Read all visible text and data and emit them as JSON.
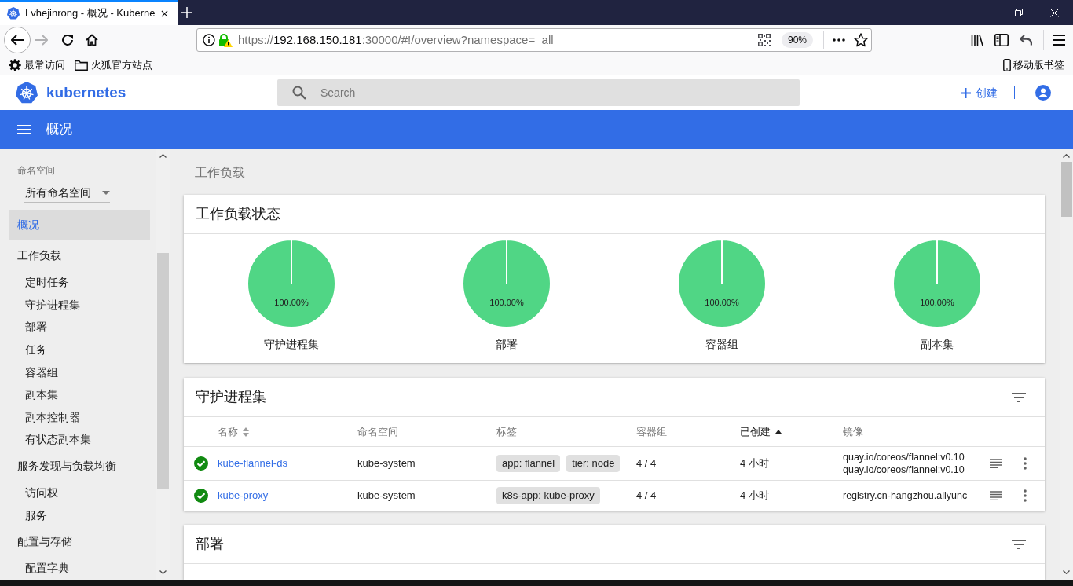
{
  "browser": {
    "tabs": [
      {
        "title": "Lvhejinrong - 概况 - Kuberne",
        "selected": true
      }
    ],
    "address_bar": {
      "scheme": "https://",
      "host": "192.168.150.181",
      "path": ":30000/#!/overview?namespace=_all",
      "zoom": "90%"
    },
    "bookmarks": [
      {
        "kind": "most_visited",
        "label": "最常访问"
      },
      {
        "kind": "folder",
        "label": "火狐官方站点"
      }
    ],
    "mobile_bookmarks": "移动版书签"
  },
  "header": {
    "logo": "kubernetes",
    "search": {
      "placeholder": "Search"
    },
    "create": "创建"
  },
  "toolbar": {
    "title": "概况"
  },
  "sidebar": {
    "namespace_label": "命名空间",
    "namespace": "所有命名空间",
    "items": [
      {
        "label": "概况",
        "selected": true
      },
      {
        "label": "工作负载",
        "selected": false,
        "children": [
          {
            "label": "定时任务",
            "selected": false
          },
          {
            "label": "守护进程集",
            "selected": false
          },
          {
            "label": "部署",
            "selected": false
          },
          {
            "label": "任务",
            "selected": false
          },
          {
            "label": "容器组",
            "selected": false
          },
          {
            "label": "副本集",
            "selected": false
          },
          {
            "label": "副本控制器",
            "selected": false
          },
          {
            "label": "有状态副本集",
            "selected": false
          }
        ]
      },
      {
        "label": "服务发现与负载均衡",
        "selected": false,
        "children": [
          {
            "label": "访问权",
            "selected": false
          },
          {
            "label": "服务",
            "selected": false
          }
        ]
      },
      {
        "label": "配置与存储",
        "selected": false,
        "children": [
          {
            "label": "配置字典",
            "selected": false
          }
        ]
      }
    ]
  },
  "main": {
    "section_title": "工作负载",
    "workload_status": {
      "title": "工作负载状态",
      "charts": [
        {
          "chart_data": {
            "type": "pie",
            "title": "守护进程集",
            "values": [
              100
            ],
            "value_labels": [
              "100.00%"
            ]
          }
        },
        {
          "chart_data": {
            "type": "pie",
            "title": "部署",
            "values": [
              100
            ],
            "value_labels": [
              "100.00%"
            ]
          }
        },
        {
          "chart_data": {
            "type": "pie",
            "title": "容器组",
            "values": [
              100
            ],
            "value_labels": [
              "100.00%"
            ]
          }
        },
        {
          "chart_data": {
            "type": "pie",
            "title": "副本集",
            "values": [
              100
            ],
            "value_labels": [
              "100.00%"
            ]
          }
        }
      ]
    },
    "daemon_sets": {
      "title": "守护进程集",
      "columns": [
        {
          "label": "名称",
          "sort_arrows": true,
          "sorted": false
        },
        {
          "label": "命名空间",
          "sort_arrows": false,
          "sorted": false
        },
        {
          "label": "标签",
          "sort_arrows": false,
          "sorted": false
        },
        {
          "label": "容器组",
          "sort_arrows": false,
          "sorted": false
        },
        {
          "label": "已创建",
          "sort_arrows": false,
          "sorted": true
        },
        {
          "label": "镜像",
          "sort_arrows": false,
          "sorted": false
        }
      ],
      "rows": [
        {
          "healthy": true,
          "name": "kube-flannel-ds",
          "namespace": "kube-system",
          "labels": [
            "app: flannel",
            "tier: node"
          ],
          "pods": "4 / 4",
          "created": "4 小时",
          "images": [
            "quay.io/coreos/flannel:v0.10",
            "quay.io/coreos/flannel:v0.10"
          ]
        },
        {
          "healthy": true,
          "name": "kube-proxy",
          "namespace": "kube-system",
          "labels": [
            "k8s-app: kube-proxy"
          ],
          "pods": "4 / 4",
          "created": "4 小时",
          "images": [
            "registry.cn-hangzhou.aliyunc"
          ]
        }
      ]
    },
    "deployments": {
      "title": "部署"
    }
  }
}
